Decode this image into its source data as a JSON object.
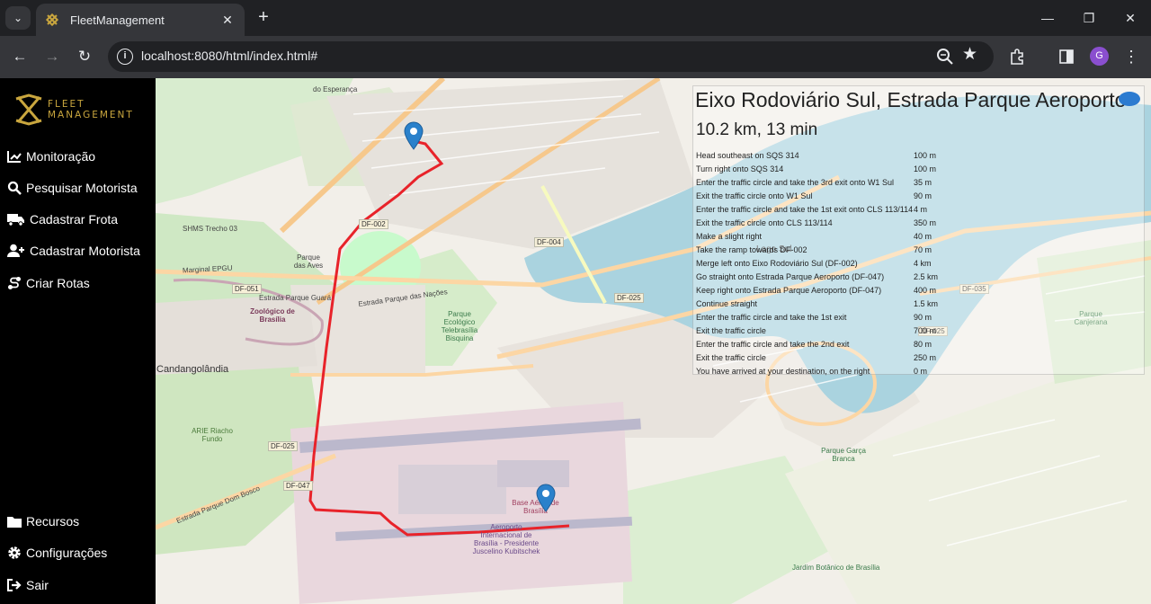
{
  "browser": {
    "tab_title": "FleetManagement",
    "url": "localhost:8080/html/index.html#",
    "profile_initial": "G"
  },
  "sidebar": {
    "logo_line1": "FLEET",
    "logo_line2": "MANAGEMENT",
    "items": [
      {
        "label": "Monitoração",
        "icon": "chart-line-icon"
      },
      {
        "label": "Pesquisar Motorista",
        "icon": "search-icon"
      },
      {
        "label": "Cadastrar Frota",
        "icon": "truck-icon"
      },
      {
        "label": "Cadastrar Motorista",
        "icon": "user-plus-icon"
      },
      {
        "label": "Criar Rotas",
        "icon": "route-icon"
      }
    ],
    "bottom_items": [
      {
        "label": "Recursos",
        "icon": "folder-icon"
      },
      {
        "label": "Configurações",
        "icon": "gear-icon"
      },
      {
        "label": "Sair",
        "icon": "sign-out-icon"
      }
    ]
  },
  "map": {
    "labels": {
      "esperanca": "do Esperança",
      "parque_aves": "Parque das Aves",
      "zoologico": "Zoológico de Brasília",
      "candangolandia": "Candangolândia",
      "riacho_fundo": "ARIE Riacho Fundo",
      "parque_ecologico": "Parque Ecológico Telebrasília Bisquina",
      "lago_sul": "Lago Sul",
      "base_aerea": "Base Aérea de Brasília",
      "aeroporto": "Aeroporto Internacional de Brasília - Presidente Juscelino Kubitschek",
      "garca_branca": "Parque Garça Branca",
      "canjerana": "Parque Canjerana",
      "jardim_botanico": "Jardim Botânico de Brasília",
      "marginal": "Marginal EPGU",
      "estrada_guara": "Estrada Parque Guará",
      "estrada_nacoes": "Estrada Parque das Nações",
      "estrada_dom_bosco": "Estrada Parque Dom Bosco",
      "shms": "SHMS Trecho 03"
    },
    "shields": [
      "DF-002",
      "DF-004",
      "DF-051",
      "DF-025",
      "DF-025",
      "DF-047",
      "DF-035",
      "DF-025"
    ]
  },
  "route": {
    "title": "Eixo Rodoviário Sul, Estrada Parque Aeroporto",
    "summary": "10.2 km, 13 min",
    "steps": [
      {
        "instruction": "Head southeast on SQS 314",
        "distance": "100 m"
      },
      {
        "instruction": "Turn right onto SQS 314",
        "distance": "100 m"
      },
      {
        "instruction": "Enter the traffic circle and take the 3rd exit onto W1 Sul",
        "distance": "35 m"
      },
      {
        "instruction": "Exit the traffic circle onto W1 Sul",
        "distance": "90 m"
      },
      {
        "instruction": "Enter the traffic circle and take the 1st exit onto CLS 113/114",
        "distance": "4 m"
      },
      {
        "instruction": "Exit the traffic circle onto CLS 113/114",
        "distance": "350 m"
      },
      {
        "instruction": "Make a slight right",
        "distance": "40 m"
      },
      {
        "instruction": "Take the ramp towards DF-002",
        "distance": "70 m"
      },
      {
        "instruction": "Merge left onto Eixo Rodoviário Sul (DF-002)",
        "distance": "4 km"
      },
      {
        "instruction": "Go straight onto Estrada Parque Aeroporto (DF-047)",
        "distance": "2.5 km"
      },
      {
        "instruction": "Keep right onto Estrada Parque Aeroporto (DF-047)",
        "distance": "400 m"
      },
      {
        "instruction": "Continue straight",
        "distance": "1.5 km"
      },
      {
        "instruction": "Enter the traffic circle and take the 1st exit",
        "distance": "90 m"
      },
      {
        "instruction": "Exit the traffic circle",
        "distance": "700 m"
      },
      {
        "instruction": "Enter the traffic circle and take the 2nd exit",
        "distance": "80 m"
      },
      {
        "instruction": "Exit the traffic circle",
        "distance": "250 m"
      },
      {
        "instruction": "You have arrived at your destination, on the right",
        "distance": "0 m"
      }
    ]
  },
  "colors": {
    "route_line": "#e8232a",
    "marker": "#2a81cb",
    "water": "#aad3df",
    "park": "#c8facc",
    "road_major": "#fcd6a4",
    "logo_gold": "#c9a63e"
  }
}
